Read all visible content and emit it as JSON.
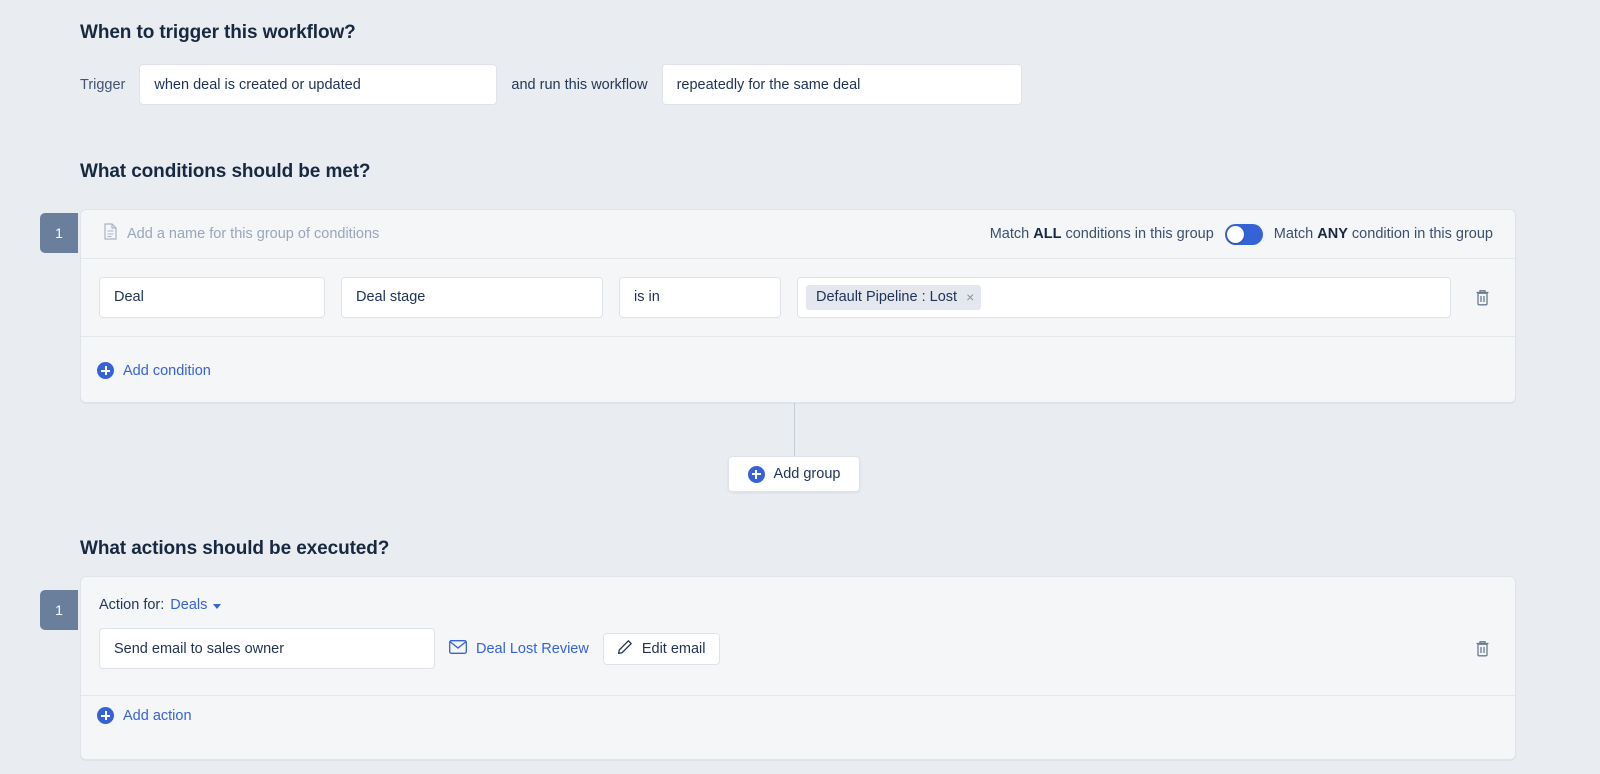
{
  "trigger_section": {
    "heading": "When to trigger this workflow?",
    "trigger_label": "Trigger",
    "trigger_value": "when deal is created or updated",
    "middle_label": "and run this workflow",
    "run_value": "repeatedly for the same deal"
  },
  "conditions_section": {
    "heading": "What conditions should be met?",
    "group": {
      "number": "1",
      "name_placeholder": "Add a name for this group of conditions",
      "match_all_prefix": "Match ",
      "match_all_strong": "ALL",
      "match_all_suffix": " conditions in this group",
      "match_any_prefix": "Match ",
      "match_any_strong": "ANY",
      "match_any_suffix": " condition in this group",
      "toggle_state": "all",
      "condition": {
        "entity": "Deal",
        "property": "Deal stage",
        "operator": "is in",
        "value_chips": [
          "Default Pipeline : Lost"
        ],
        "remove_chip_label": "×",
        "delete_label": "delete-condition"
      },
      "add_condition_label": "Add condition"
    },
    "add_group_label": "Add group"
  },
  "actions_section": {
    "heading": "What actions should be executed?",
    "group": {
      "number": "1",
      "action_for_label": "Action for:",
      "action_for_value": "Deals",
      "action_value": "Send email to sales owner",
      "email_template_name": "Deal Lost Review",
      "edit_email_label": "Edit email",
      "add_action_label": "Add action",
      "delete_label": "delete-action"
    }
  },
  "colors": {
    "page_background": "#e9edf2",
    "card_background": "#f4f6f8",
    "accent_blue": "#3563d6",
    "badge_slate": "#6a7f9c",
    "text_primary": "#172b4d",
    "chip_background": "#e4e8ee"
  }
}
